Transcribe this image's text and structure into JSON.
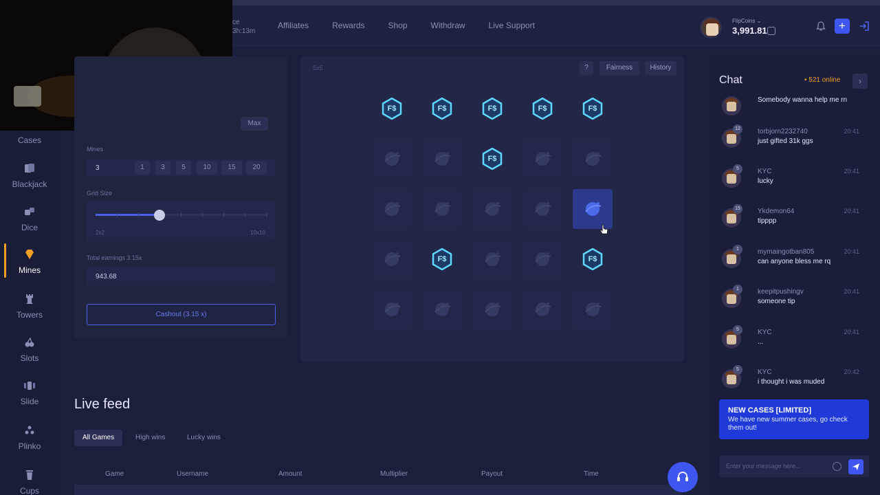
{
  "nav": {
    "partial_label": "ce",
    "partial_timer": "3h:13m",
    "items": [
      "Affiliates",
      "Rewards",
      "Shop",
      "Withdraw",
      "Live Support"
    ]
  },
  "wallet": {
    "label": "FlipCoins",
    "amount": "3,991.81"
  },
  "sidebar": {
    "items": [
      {
        "label": "Cases",
        "icon": "cases-icon"
      },
      {
        "label": "Blackjack",
        "icon": "cards-icon"
      },
      {
        "label": "Dice",
        "icon": "dice-icon"
      },
      {
        "label": "Mines",
        "icon": "diamond-icon",
        "active": true
      },
      {
        "label": "Towers",
        "icon": "tower-icon"
      },
      {
        "label": "Slots",
        "icon": "cherry-icon"
      },
      {
        "label": "Slide",
        "icon": "slide-icon"
      },
      {
        "label": "Plinko",
        "icon": "plinko-icon"
      },
      {
        "label": "Cups",
        "icon": "cup-icon"
      }
    ]
  },
  "controls": {
    "max_label": "Max",
    "mines_label": "Mines",
    "mines_value": "3",
    "mine_options": [
      "1",
      "3",
      "5",
      "10",
      "15",
      "20"
    ],
    "grid_size_label": "Grid Size",
    "grid_min": "2x2",
    "grid_max": "10x10",
    "earnings_label": "Total earnings 3.15x",
    "earnings_value": "943.68",
    "cashout_label": "Cashout (3.15 x)"
  },
  "board": {
    "grid_label": "5x5",
    "help": "?",
    "fairness": "Fairness",
    "history": "History",
    "coin_text": "F$",
    "cells": [
      [
        "coin",
        "coin",
        "coin",
        "coin",
        "coin"
      ],
      [
        "hidden",
        "hidden",
        "coin",
        "hidden",
        "hidden"
      ],
      [
        "hidden",
        "hidden",
        "hidden",
        "hidden",
        "selected"
      ],
      [
        "hidden",
        "coin",
        "hidden",
        "hidden",
        "coin"
      ],
      [
        "hidden",
        "hidden",
        "hidden",
        "hidden",
        "hidden"
      ]
    ]
  },
  "live_feed": {
    "title": "Live feed",
    "tabs": [
      "All Games",
      "High wins",
      "Lucky wins"
    ],
    "columns": [
      "Game",
      "Username",
      "Amount",
      "Multiplier",
      "Payout",
      "Time"
    ]
  },
  "chat": {
    "title": "Chat",
    "online": "• 521 online",
    "messages": [
      {
        "name": "",
        "level": "",
        "time": "",
        "text": "Somebody wanna help me rn"
      },
      {
        "name": "torbjorn2232740",
        "level": "12",
        "time": "20:41",
        "text": "just gifted 31k ggs"
      },
      {
        "name": "KYC",
        "level": "5",
        "time": "20:41",
        "text": "lucky"
      },
      {
        "name": "Ykdemon64",
        "level": "15",
        "time": "20:41",
        "text": "tipppp"
      },
      {
        "name": "mymaingotban805",
        "level": "1",
        "time": "20:41",
        "text": "can anyone bless me rq"
      },
      {
        "name": "keepitpushingv",
        "level": "1",
        "time": "20:41",
        "text": "someone tip"
      },
      {
        "name": "KYC",
        "level": "5",
        "time": "20:41",
        "text": "..."
      },
      {
        "name": "KYC",
        "level": "5",
        "time": "20:42",
        "text": "i thought i was muded"
      }
    ],
    "notice_title": "NEW CASES [LIMITED]",
    "notice_body": "We have new summer cases, go check them out!",
    "input_placeholder": "Enter your message here..."
  },
  "colors": {
    "accent": "#3f56f0",
    "mines_active": "#f0a020",
    "coin": "#5fd6ff"
  }
}
